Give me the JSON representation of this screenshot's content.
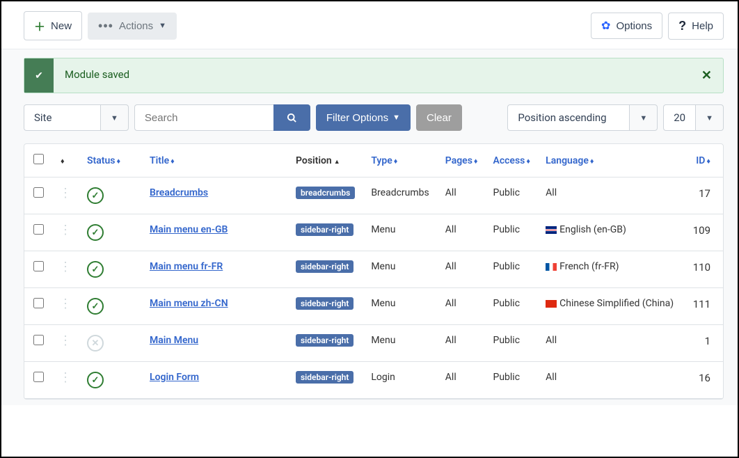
{
  "toolbar": {
    "new": "New",
    "actions": "Actions",
    "options": "Options",
    "help": "Help"
  },
  "alert": {
    "message": "Module saved"
  },
  "filters": {
    "site": "Site",
    "search_placeholder": "Search",
    "filter_options": "Filter Options",
    "clear": "Clear",
    "sort": "Position ascending",
    "limit": "20"
  },
  "columns": {
    "status": "Status",
    "title": "Title",
    "position": "Position",
    "type": "Type",
    "pages": "Pages",
    "access": "Access",
    "language": "Language",
    "id": "ID"
  },
  "rows": [
    {
      "status": "published",
      "title": "Breadcrumbs",
      "position": "breadcrumbs",
      "type": "Breadcrumbs",
      "pages": "All",
      "access": "Public",
      "language_text": "All",
      "flag": "",
      "id": "17"
    },
    {
      "status": "published",
      "title": "Main menu en-GB",
      "position": "sidebar-right",
      "type": "Menu",
      "pages": "All",
      "access": "Public",
      "language_text": "English (en-GB)",
      "flag": "gb",
      "id": "109"
    },
    {
      "status": "published",
      "title": "Main menu fr-FR",
      "position": "sidebar-right",
      "type": "Menu",
      "pages": "All",
      "access": "Public",
      "language_text": "French (fr-FR)",
      "flag": "fr",
      "id": "110"
    },
    {
      "status": "published",
      "title": "Main menu zh-CN",
      "position": "sidebar-right",
      "type": "Menu",
      "pages": "All",
      "access": "Public",
      "language_text": "Chinese Simplified (China)",
      "flag": "cn",
      "id": "111"
    },
    {
      "status": "unpublished",
      "title": "Main Menu",
      "position": "sidebar-right",
      "type": "Menu",
      "pages": "All",
      "access": "Public",
      "language_text": "All",
      "flag": "",
      "id": "1"
    },
    {
      "status": "published",
      "title": "Login Form",
      "position": "sidebar-right",
      "type": "Login",
      "pages": "All",
      "access": "Public",
      "language_text": "All",
      "flag": "",
      "id": "16"
    }
  ]
}
